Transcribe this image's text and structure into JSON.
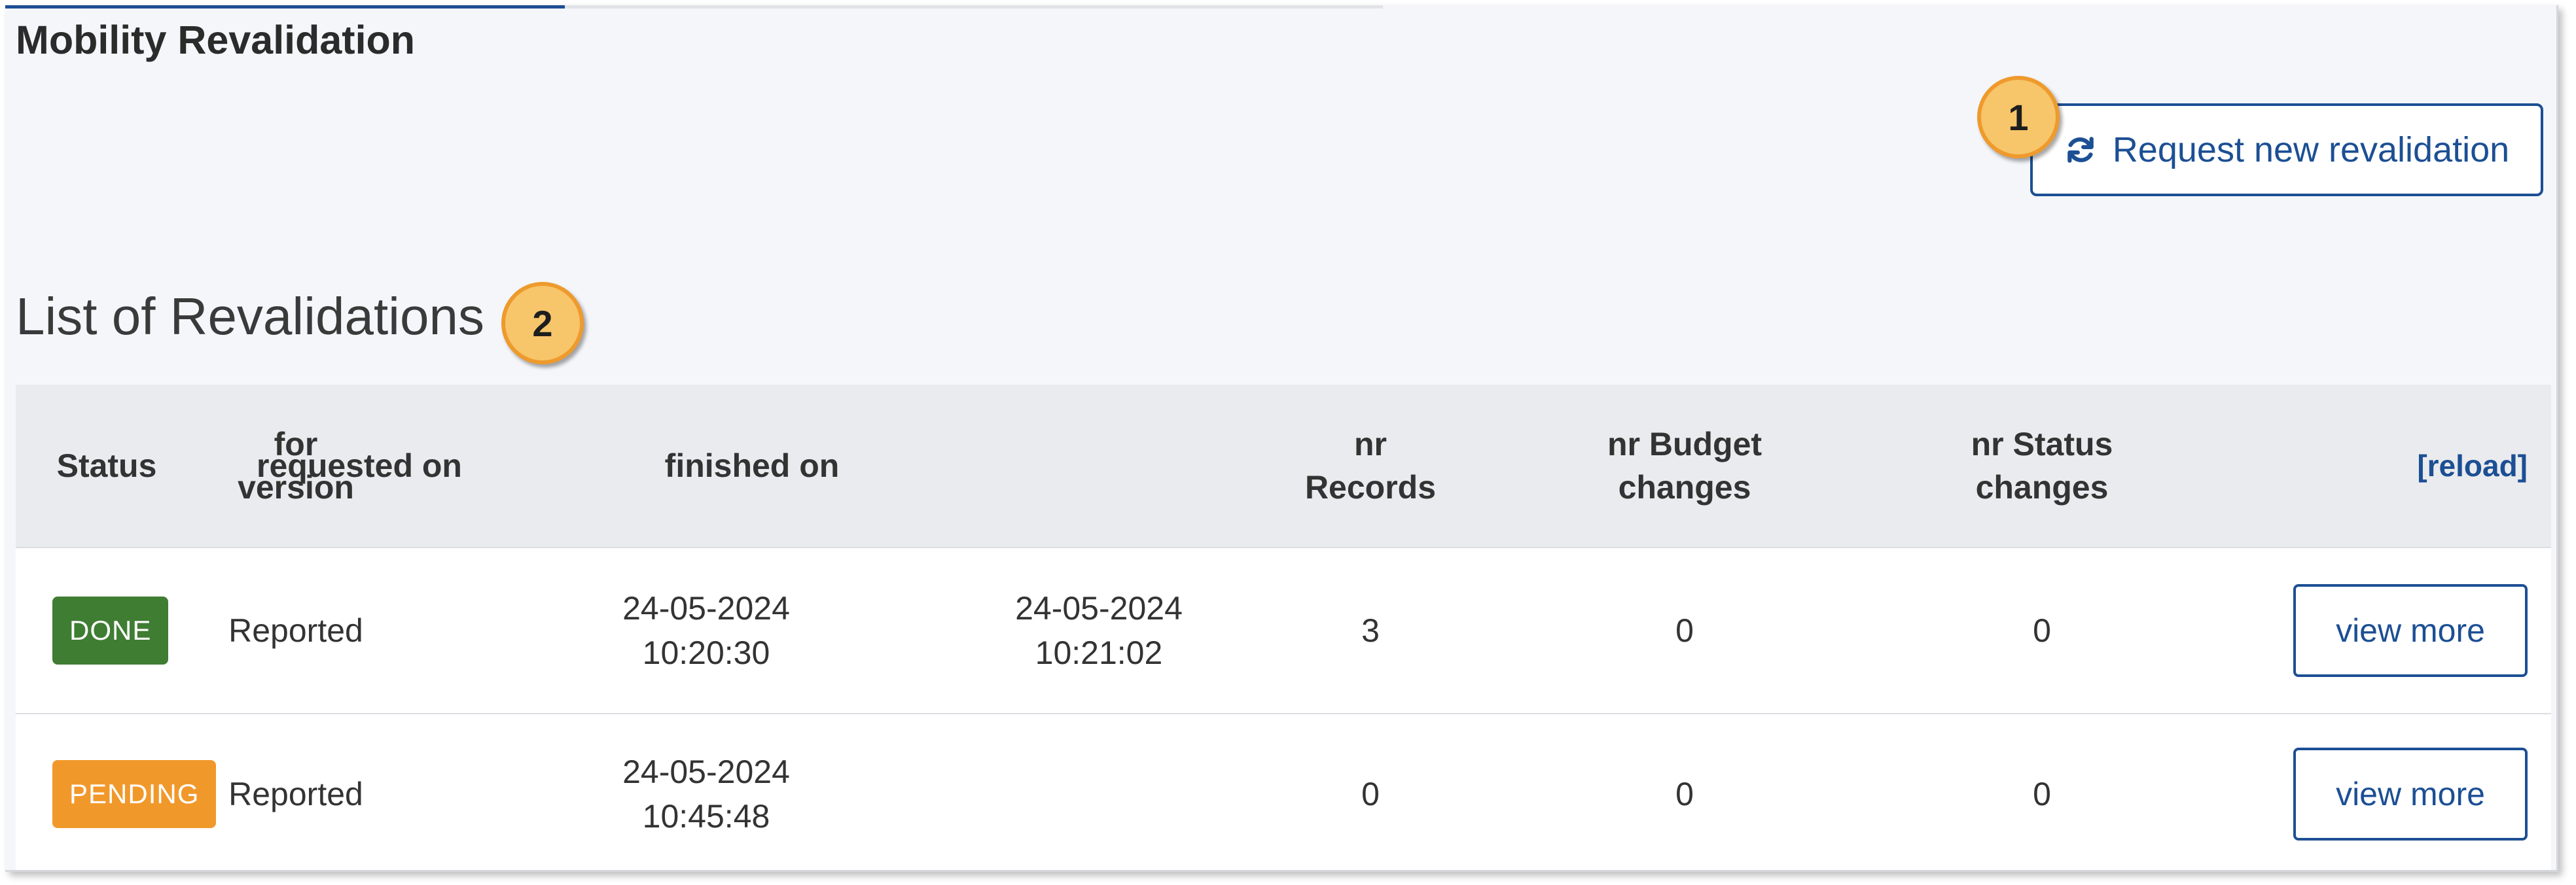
{
  "page": {
    "title": "Mobility Revalidation",
    "request_button_label": "Request new revalidation",
    "section_title": "List of Revalidations"
  },
  "callouts": [
    "1",
    "2"
  ],
  "table": {
    "headers": {
      "status": "Status",
      "for_version_line1": "for",
      "for_version_line2": "version",
      "requested_on": "requested on",
      "finished_on": "finished on",
      "nr_records_line1": "nr",
      "nr_records_line2": "Records",
      "nr_budget_line1": "nr Budget",
      "nr_budget_line2": "changes",
      "nr_status_line1": "nr Status",
      "nr_status_line2": "changes",
      "reload": "[reload]"
    },
    "rows": [
      {
        "status": "DONE",
        "for_version": "Reported",
        "requested_date": "24-05-2024",
        "requested_time": "10:20:30",
        "finished_date": "24-05-2024",
        "finished_time": "10:21:02",
        "nr_records": "3",
        "nr_budget_changes": "0",
        "nr_status_changes": "0",
        "action_label": "view more"
      },
      {
        "status": "PENDING",
        "for_version": "Reported",
        "requested_date": "24-05-2024",
        "requested_time": "10:45:48",
        "finished_date": "",
        "finished_time": "",
        "nr_records": "0",
        "nr_budget_changes": "0",
        "nr_status_changes": "0",
        "action_label": "view more"
      }
    ]
  },
  "icons": {
    "request_button_icon": "refresh-icon"
  },
  "colors": {
    "accent": "#1c4f94",
    "done_badge": "#3f7d33",
    "pending_badge": "#f1982b",
    "callout_fill": "#f7c56a",
    "callout_border": "#ee9a2c",
    "panel_background": "#f5f6fa",
    "header_background": "#eaebee"
  }
}
